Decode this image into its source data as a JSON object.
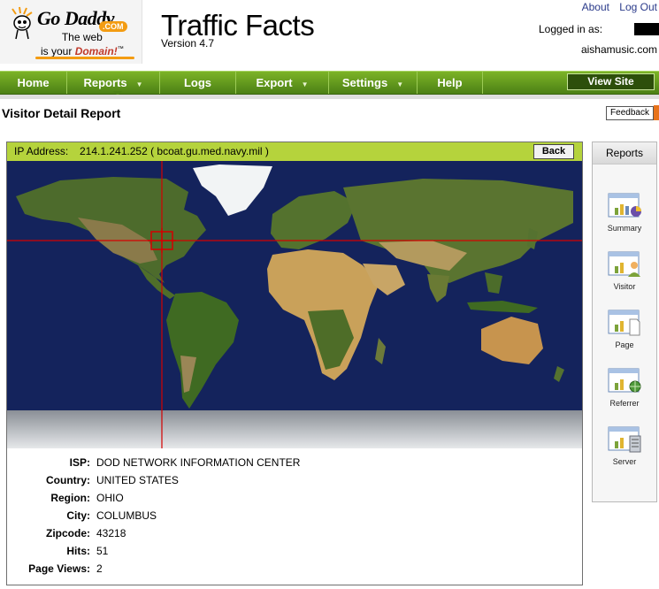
{
  "brand": {
    "logo_name": "Go Daddy",
    "logo_com": ".COM",
    "tagline_line1": "The web",
    "tagline_line2": "is your",
    "tagline_emph": "Domain!",
    "tm": "™"
  },
  "app": {
    "title": "Traffic Facts",
    "version": "Version 4.7"
  },
  "top_links": {
    "about": "About",
    "logout": "Log Out"
  },
  "account": {
    "logged_in_label": "Logged in as:",
    "site": "aishamusic.com"
  },
  "nav": {
    "items": [
      {
        "label": "Home",
        "dropdown": false
      },
      {
        "label": "Reports",
        "dropdown": true
      },
      {
        "label": "Logs",
        "dropdown": false
      },
      {
        "label": "Export",
        "dropdown": true
      },
      {
        "label": "Settings",
        "dropdown": true
      },
      {
        "label": "Help",
        "dropdown": false
      }
    ],
    "view_site": "View Site",
    "caret": "▼"
  },
  "page": {
    "title": "Visitor Detail Report",
    "feedback": "Feedback"
  },
  "visitor": {
    "ip_label": "IP Address:",
    "ip_value": "214.1.241.252  ( bcoat.gu.med.navy.mil )",
    "back": "Back",
    "details": [
      {
        "key": "ISP:",
        "value": "DOD NETWORK INFORMATION CENTER"
      },
      {
        "key": "Country:",
        "value": "UNITED STATES"
      },
      {
        "key": "Region:",
        "value": "OHIO"
      },
      {
        "key": "City:",
        "value": "COLUMBUS"
      },
      {
        "key": "Zipcode:",
        "value": "43218"
      },
      {
        "key": "Hits:",
        "value": "51"
      },
      {
        "key": "Page Views:",
        "value": "2"
      }
    ]
  },
  "sidebar": {
    "title": "Reports",
    "items": [
      {
        "label": "Summary",
        "icon": "summary-report-icon"
      },
      {
        "label": "Visitor",
        "icon": "visitor-report-icon"
      },
      {
        "label": "Page",
        "icon": "page-report-icon"
      },
      {
        "label": "Referrer",
        "icon": "referrer-report-icon"
      },
      {
        "label": "Server",
        "icon": "server-report-icon"
      }
    ]
  },
  "colors": {
    "nav_green": "#5e9a1c",
    "ip_bar": "#b5d33c",
    "ocean": "#14235c",
    "crosshair": "#d40000",
    "feedback_accent": "#e8731b"
  }
}
